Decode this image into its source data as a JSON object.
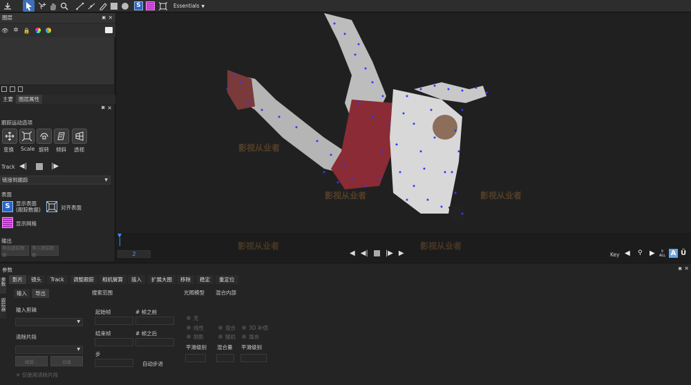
{
  "toolbar": {
    "workspace": "Essentials"
  },
  "layers_panel": {
    "title": "图层",
    "tabs": [
      "主要",
      "图层属性"
    ]
  },
  "track_panel": {
    "section_title": "跟踪运动选项",
    "motion_buttons": [
      "变换",
      "Scale",
      "旋转",
      "倾斜",
      "透视"
    ],
    "track_label": "Track",
    "link_select": "链接到跟踪",
    "surface_label": "表面",
    "show_surface": "显示表面\n(跟踪数据)",
    "align_surface": "对齐表面",
    "show_grid": "显示网格",
    "output_label": "输出",
    "output_buttons": [
      "导出跟踪数据",
      "导入跟踪数据"
    ]
  },
  "canvas": {
    "watermark": "影视从业者",
    "frame_number": "2"
  },
  "transport": {
    "key_label": "Key",
    "all_label": "ALL",
    "a_label": "A",
    "u_label": "Ü"
  },
  "params": {
    "title": "参数",
    "side_tabs": [
      "参数",
      "跟踪器"
    ],
    "tabs": [
      "影片",
      "镜头",
      "Track",
      "调整跟踪",
      "相机解算",
      "插入",
      "扩展大图",
      "移除",
      "稳定",
      "重定位"
    ],
    "sub_tabs": [
      "输入",
      "导出"
    ],
    "input_clip": "输入剪辑",
    "clean_plate": "清除片段",
    "clean_buttons": [
      "编辑...",
      "创建"
    ],
    "clean_check": "仅使用清除片段",
    "search_range": "搜索范围",
    "start_frame": "起始帧",
    "frames_before": "# 帧之前",
    "end_frame": "结束帧",
    "frames_after": "# 帧之后",
    "step": "步",
    "auto_step": "自动步进",
    "lighting_model": "光照模型",
    "blend_inside": "混合内部",
    "lighting_options": [
      "无",
      "线性",
      "混合",
      "3D 补偿",
      "阴影",
      "随机",
      "填充"
    ],
    "smooth_level_1": "平滑级别",
    "blend_amount": "混合量",
    "smooth_level_2": "平滑级别"
  }
}
